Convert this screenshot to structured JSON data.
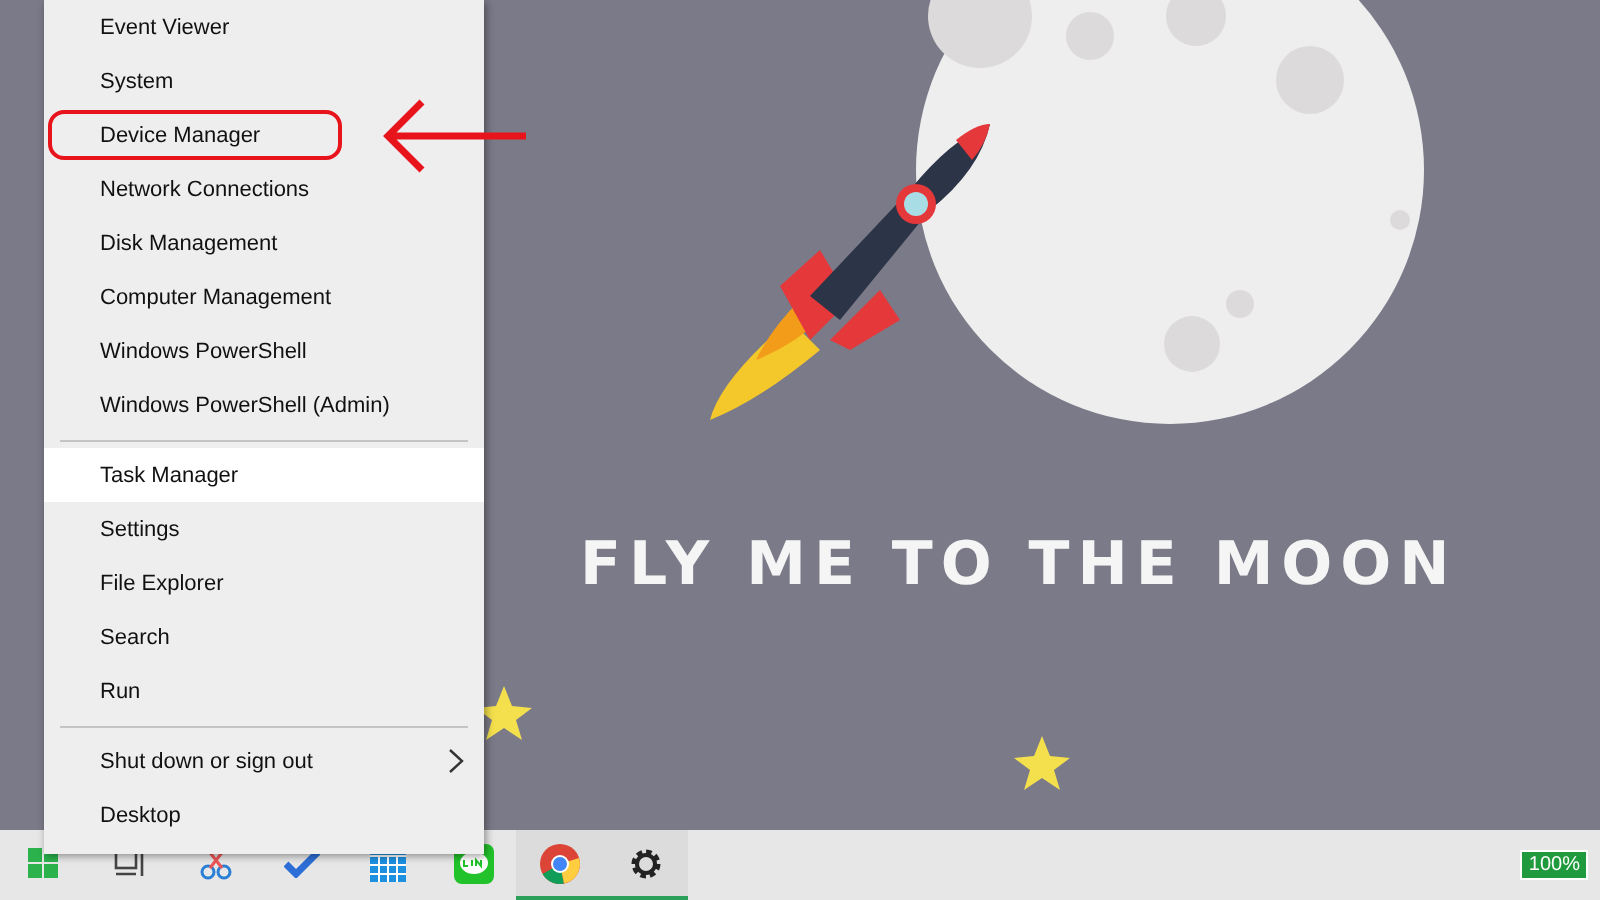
{
  "wallpaper": {
    "text": "FLY ME TO THE MOON"
  },
  "context_menu": {
    "groups": [
      {
        "items": [
          {
            "label": "Event Viewer",
            "selected": false,
            "annotated": false,
            "kind": "action"
          },
          {
            "label": "System",
            "selected": false,
            "annotated": false,
            "kind": "action"
          },
          {
            "label": "Device Manager",
            "selected": false,
            "annotated": true,
            "kind": "action"
          },
          {
            "label": "Network Connections",
            "selected": false,
            "annotated": false,
            "kind": "action"
          },
          {
            "label": "Disk Management",
            "selected": false,
            "annotated": false,
            "kind": "action"
          },
          {
            "label": "Computer Management",
            "selected": false,
            "annotated": false,
            "kind": "action"
          },
          {
            "label": "Windows PowerShell",
            "selected": false,
            "annotated": false,
            "kind": "action"
          },
          {
            "label": "Windows PowerShell (Admin)",
            "selected": false,
            "annotated": false,
            "kind": "action"
          }
        ]
      },
      {
        "items": [
          {
            "label": "Task Manager",
            "selected": true,
            "annotated": false,
            "kind": "action"
          },
          {
            "label": "Settings",
            "selected": false,
            "annotated": false,
            "kind": "action"
          },
          {
            "label": "File Explorer",
            "selected": false,
            "annotated": false,
            "kind": "action"
          },
          {
            "label": "Search",
            "selected": false,
            "annotated": false,
            "kind": "action"
          },
          {
            "label": "Run",
            "selected": false,
            "annotated": false,
            "kind": "action"
          }
        ]
      },
      {
        "items": [
          {
            "label": "Shut down or sign out",
            "selected": false,
            "annotated": false,
            "kind": "submenu"
          },
          {
            "label": "Desktop",
            "selected": false,
            "annotated": false,
            "kind": "action"
          }
        ]
      }
    ]
  },
  "taskbar": {
    "apps": [
      {
        "kind": "taskview",
        "running": false
      },
      {
        "kind": "scissors",
        "running": false
      },
      {
        "kind": "todo",
        "running": false
      },
      {
        "kind": "calendar",
        "running": false
      },
      {
        "kind": "chat",
        "running": false
      },
      {
        "kind": "browser",
        "running": true
      },
      {
        "kind": "settings",
        "running": true
      }
    ],
    "battery": "100%"
  }
}
